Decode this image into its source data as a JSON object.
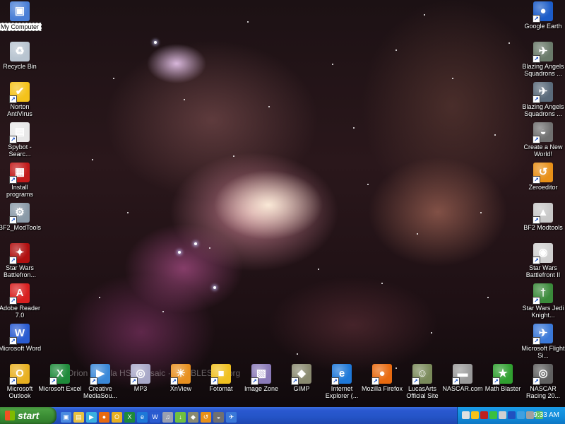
{
  "wallpaper": {
    "caption": "Orion Nebula HST Mosaic · HUBBLESITE.org"
  },
  "desktop_left": [
    {
      "label": "My Computer",
      "color": "#4a7fd6",
      "glyph": "▣",
      "shortcut": false,
      "selected": true
    },
    {
      "label": "Recycle Bin",
      "color": "#b8c4d0",
      "glyph": "♻",
      "shortcut": false
    },
    {
      "label": "Norton AntiVirus",
      "color": "#f4c21a",
      "glyph": "✔",
      "shortcut": true
    },
    {
      "label": "Spybot - Searc...",
      "color": "#e8e8e8",
      "glyph": "▤",
      "shortcut": true
    },
    {
      "label": "Install programs",
      "color": "#c21a1a",
      "glyph": "▦",
      "shortcut": true
    },
    {
      "label": "BF2_ModTools",
      "color": "#8a9aa8",
      "glyph": "⚙",
      "shortcut": true
    },
    {
      "label": "Star Wars Battlefron...",
      "color": "#b01010",
      "glyph": "✦",
      "shortcut": true
    },
    {
      "label": "Adobe Reader 7.0",
      "color": "#d82020",
      "glyph": "A",
      "shortcut": true
    },
    {
      "label": "Microsoft Word",
      "color": "#2a5bd0",
      "glyph": "W",
      "shortcut": true
    },
    {
      "label": "Microsoft Outlook",
      "color": "#e8b020",
      "glyph": "O",
      "shortcut": true
    }
  ],
  "desktop_right": [
    {
      "label": "Google Earth",
      "color": "#1c5cc8",
      "glyph": "●",
      "shortcut": true
    },
    {
      "label": "Blazing Angels Squadrons ...",
      "color": "#6a7a6a",
      "glyph": "✈",
      "shortcut": true
    },
    {
      "label": "Blazing Angels Squadrons ...",
      "color": "#5a6a7a",
      "glyph": "✈",
      "shortcut": true
    },
    {
      "label": "Create a New World!",
      "color": "#707070",
      "glyph": "◒",
      "shortcut": true
    },
    {
      "label": "Zeroeditor",
      "color": "#e89018",
      "glyph": "↺",
      "shortcut": true
    },
    {
      "label": "BF2 Modtools",
      "color": "#c8c8c8",
      "glyph": "▲",
      "shortcut": true
    },
    {
      "label": "Star Wars Battlefront II",
      "color": "#d0d0d0",
      "glyph": "◉",
      "shortcut": true
    },
    {
      "label": "Star Wars Jedi Knight...",
      "color": "#3a8a3a",
      "glyph": "†",
      "shortcut": true
    },
    {
      "label": "Microsoft Flight Si...",
      "color": "#3a78d8",
      "glyph": "✈",
      "shortcut": true
    },
    {
      "label": "NASCAR Racing 20...",
      "color": "#606060",
      "glyph": "◎",
      "shortcut": true
    }
  ],
  "desktop_bottom": [
    {
      "label": "Microsoft Excel",
      "color": "#1e8a3a",
      "glyph": "X",
      "shortcut": true
    },
    {
      "label": "Creative MediaSou...",
      "color": "#3a88d8",
      "glyph": "▶",
      "shortcut": true
    },
    {
      "label": "MP3",
      "color": "#a8a8c8",
      "glyph": "◎",
      "shortcut": true
    },
    {
      "label": "XnView",
      "color": "#e89020",
      "glyph": "☀",
      "shortcut": true
    },
    {
      "label": "Fotomat",
      "color": "#f0c020",
      "glyph": "■",
      "shortcut": true
    },
    {
      "label": "Image Zone",
      "color": "#8a7ab8",
      "glyph": "▧",
      "shortcut": true
    },
    {
      "label": "GIMP",
      "color": "#8a8a70",
      "glyph": "◆",
      "shortcut": true
    },
    {
      "label": "Internet Explorer (...",
      "color": "#1e78d8",
      "glyph": "e",
      "shortcut": true
    },
    {
      "label": "Mozilla Firefox",
      "color": "#e86a10",
      "glyph": "●",
      "shortcut": true
    },
    {
      "label": "LucasArts Official Site",
      "color": "#7a8a5a",
      "glyph": "☺",
      "shortcut": true
    },
    {
      "label": "NASCAR.com",
      "color": "#9a9a9a",
      "glyph": "▬",
      "shortcut": true
    },
    {
      "label": "Math Blaster",
      "color": "#30a030",
      "glyph": "★",
      "shortcut": true
    }
  ],
  "taskbar": {
    "start_label": "start",
    "quick_launch": [
      {
        "name": "desktop-icon",
        "color": "#4a8ae0",
        "glyph": "▣"
      },
      {
        "name": "explorer-icon",
        "color": "#e8c040",
        "glyph": "▤"
      },
      {
        "name": "media-player-icon",
        "color": "#3ab0e0",
        "glyph": "▶"
      },
      {
        "name": "firefox-icon",
        "color": "#e86a10",
        "glyph": "●"
      },
      {
        "name": "outlook-icon",
        "color": "#e8b020",
        "glyph": "O"
      },
      {
        "name": "excel-icon",
        "color": "#1e8a3a",
        "glyph": "X"
      },
      {
        "name": "ie-icon",
        "color": "#1e78d8",
        "glyph": "e"
      },
      {
        "name": "word-icon",
        "color": "#2a5bd0",
        "glyph": "W"
      },
      {
        "name": "itunes-icon",
        "color": "#9aa0b0",
        "glyph": "♫"
      },
      {
        "name": "network-icon",
        "color": "#70c040",
        "glyph": "↓"
      },
      {
        "name": "gimp-icon",
        "color": "#8a8a70",
        "glyph": "◆"
      },
      {
        "name": "zeroeditor-icon",
        "color": "#e89018",
        "glyph": "↺"
      },
      {
        "name": "game-icon",
        "color": "#707070",
        "glyph": "◒"
      },
      {
        "name": "flight-icon",
        "color": "#3a78d8",
        "glyph": "✈"
      }
    ],
    "tray_icons": [
      {
        "name": "network-tray-icon",
        "color": "#e0e0e0"
      },
      {
        "name": "norton-tray-icon",
        "color": "#f4c21a"
      },
      {
        "name": "shield-tray-icon",
        "color": "#c02020"
      },
      {
        "name": "messenger-tray-icon",
        "color": "#3ac040"
      },
      {
        "name": "volume-tray-icon",
        "color": "#d0d0d0"
      },
      {
        "name": "antivirus-tray-icon",
        "color": "#2050c0"
      },
      {
        "name": "update-tray-icon",
        "color": "#40a0e0"
      },
      {
        "name": "printer-tray-icon",
        "color": "#a0a0a0"
      },
      {
        "name": "usb-tray-icon",
        "color": "#60c060"
      }
    ],
    "clock": "9:33 AM"
  }
}
